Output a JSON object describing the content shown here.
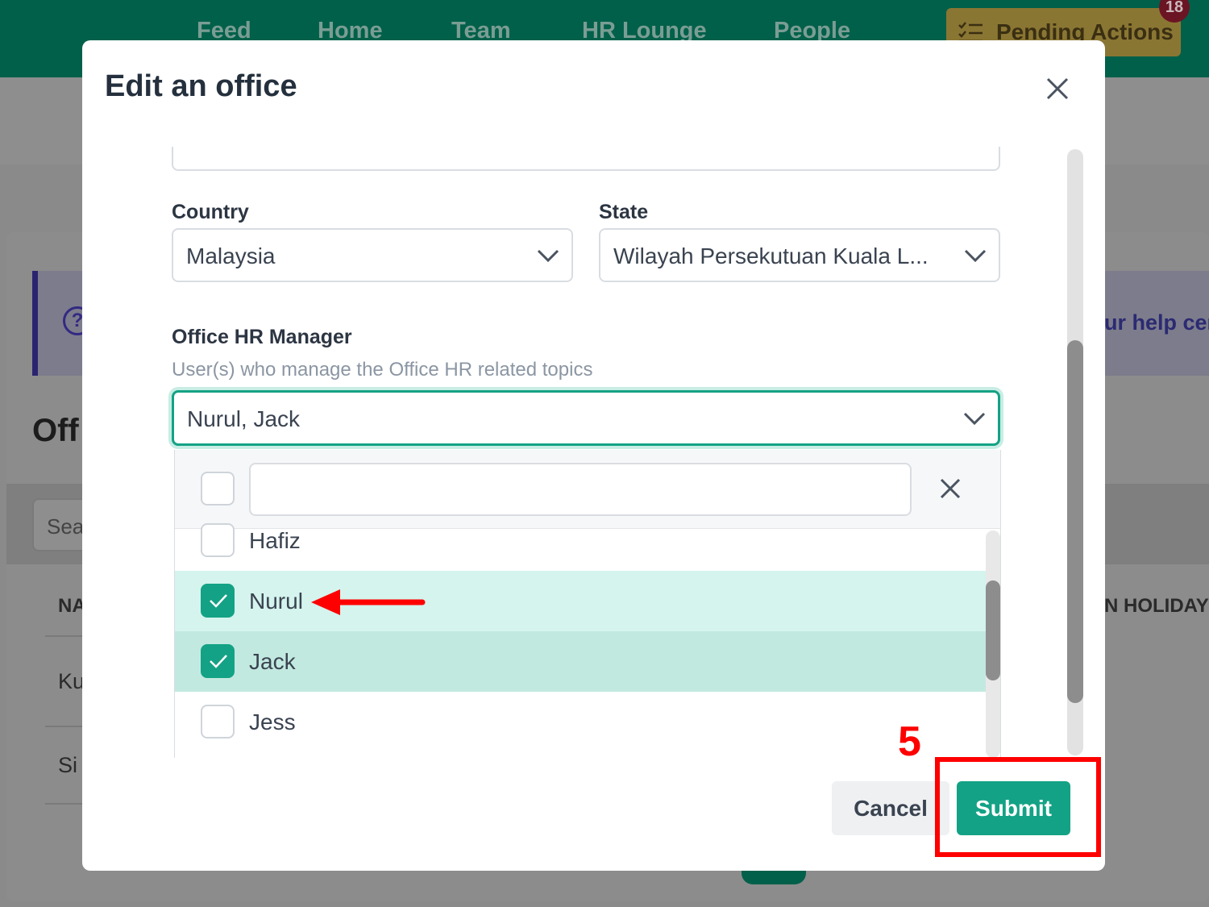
{
  "background": {
    "nav": [
      "Feed",
      "Home",
      "Team",
      "HR Lounge",
      "People"
    ],
    "pending_label": "Pending Actions",
    "pending_count": "18",
    "help_text": "ur help cer",
    "page_title": "Off",
    "search_text": "Sea",
    "col_name": "NA",
    "col_holiday": "N HOLIDAY",
    "row1": "Ku",
    "row2": "Si"
  },
  "modal": {
    "title": "Edit an office",
    "country": {
      "label": "Country",
      "value": "Malaysia"
    },
    "state": {
      "label": "State",
      "value": "Wilayah Persekutuan Kuala L..."
    },
    "hr_manager": {
      "label": "Office HR Manager",
      "helper": "User(s) who manage the Office HR related topics",
      "value": "Nurul, Jack",
      "search_value": "",
      "options": [
        {
          "name": "Hafiz",
          "checked": false
        },
        {
          "name": "Nurul",
          "checked": true
        },
        {
          "name": "Jack",
          "checked": true
        },
        {
          "name": "Jess",
          "checked": false
        }
      ]
    },
    "cancel_label": "Cancel",
    "submit_label": "Submit"
  },
  "annotation": {
    "step": "5"
  },
  "colors": {
    "accent": "#13a285",
    "nav": "#00604a",
    "highlight": "#ff0000"
  }
}
